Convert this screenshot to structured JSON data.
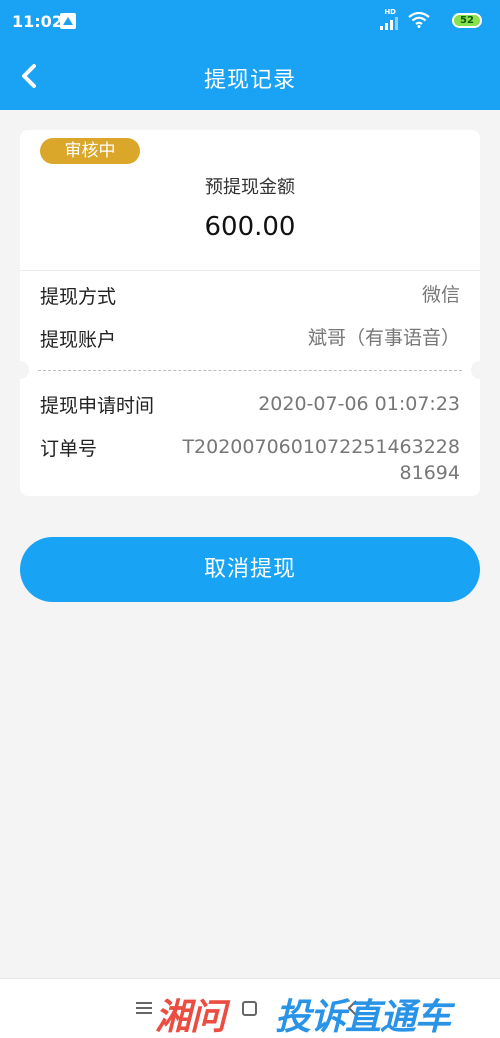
{
  "status_bar": {
    "time": "11:02",
    "network_badge": "HD",
    "battery": "52",
    "app_icon": "green-triangle-app-icon"
  },
  "header": {
    "title": "提现记录",
    "back_icon": "chevron-left-icon"
  },
  "record": {
    "status_badge": "审核中",
    "amount_label": "预提现金额",
    "amount": "600.00",
    "method_label": "提现方式",
    "method_value": "微信",
    "account_label": "提现账户",
    "account_value": "斌哥（有事语音）",
    "time_label": "提现申请时间",
    "time_value": "2020-07-06 01:07:23",
    "order_label": "订单号",
    "order_value_line1": "T202007060107225146322­8",
    "order_value_line2": "81694"
  },
  "actions": {
    "cancel_label": "取消提现"
  },
  "watermark": {
    "red_text": "湘问",
    "blue_text": "投诉直通车"
  },
  "colors": {
    "primary": "#1aa3f5",
    "badge": "#dba72b",
    "background": "#f4f4f4",
    "watermark_red": "#ea4437",
    "watermark_blue": "#1e8ee6"
  }
}
